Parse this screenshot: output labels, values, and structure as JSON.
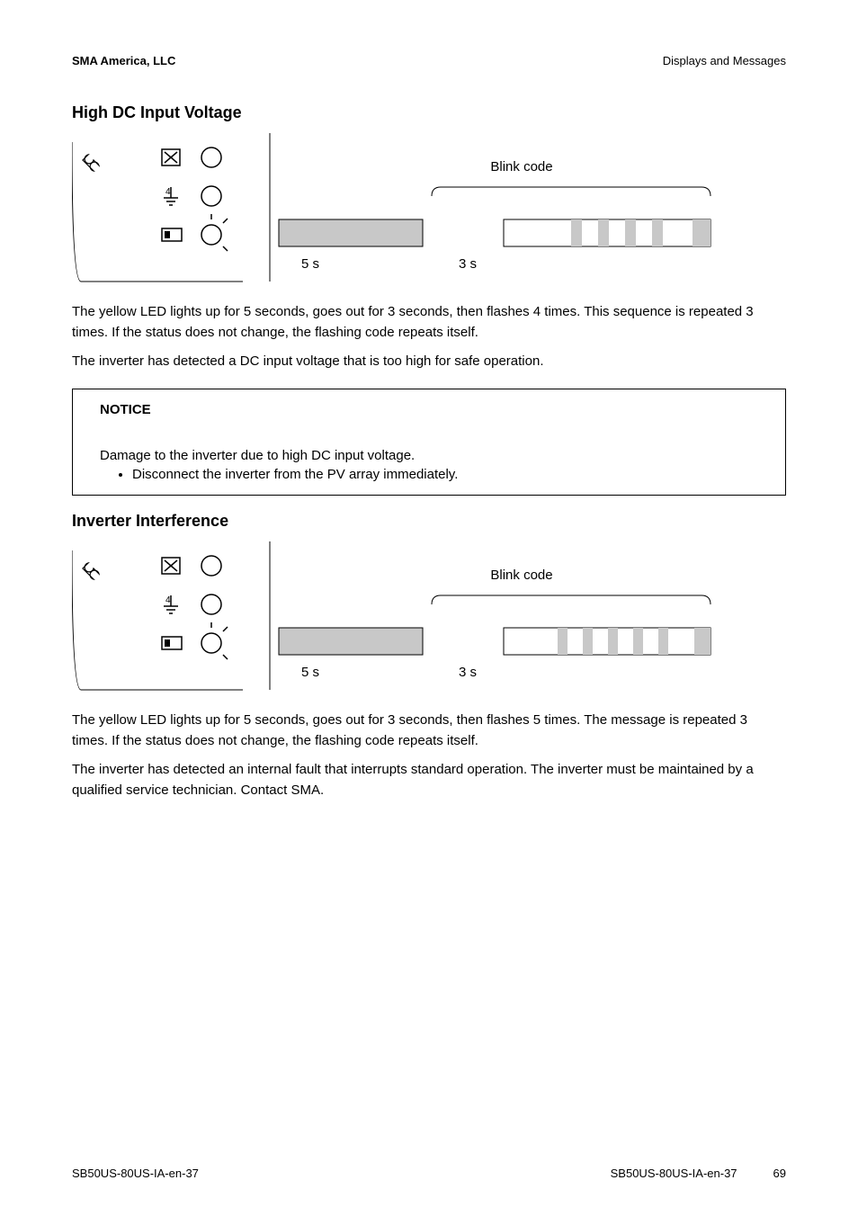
{
  "header": {
    "left": "SMA America, LLC",
    "right": "Displays and Messages"
  },
  "section1": {
    "heading": "High DC Input Voltage",
    "diagram": {
      "blink_label": "Blink code",
      "t1": "5 s",
      "t2": "3 s",
      "flashes": 4
    },
    "p1": "The yellow LED lights up for 5 seconds, goes out for 3 seconds, then flashes 4 times. This sequence is repeated 3 times. If the status does not change, the flashing code repeats itself.",
    "p2": "The inverter has detected a DC input voltage that is too high for safe operation."
  },
  "notice": {
    "title": "NOTICE",
    "line1": "Damage to the inverter due to high DC input voltage.",
    "bullet1": "Disconnect the inverter from the PV array immediately."
  },
  "section2": {
    "heading": "Inverter Interference",
    "diagram": {
      "blink_label": "Blink code",
      "t1": "5 s",
      "t2": "3 s",
      "flashes": 5
    },
    "p1": "The yellow LED lights up for 5 seconds, goes out for 3 seconds, then flashes 5 times. The message is repeated 3 times. If the status does not change, the flashing code repeats itself.",
    "p2": "The inverter has detected an internal fault that interrupts standard operation. The inverter must be maintained by a qualified service technician. Contact SMA."
  },
  "footer": {
    "left": "SB50US-80US-IA-en-37",
    "right_doc": "SB50US-80US-IA-en-37",
    "page": "69"
  }
}
